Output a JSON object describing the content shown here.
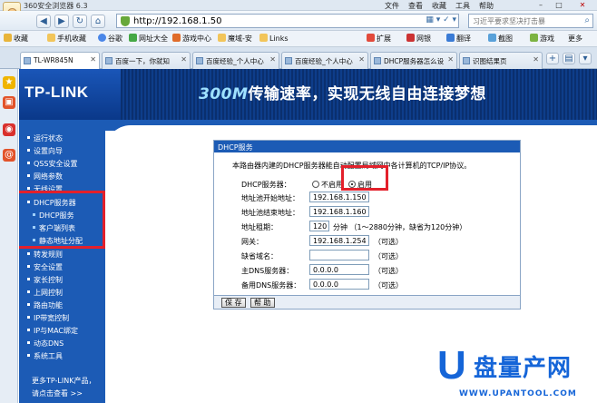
{
  "browser": {
    "title": "360安全浏览器 6.3",
    "menu": [
      "文件",
      "查看",
      "收藏",
      "工具",
      "帮助"
    ],
    "address": "http://192.168.1.50",
    "search_placeholder": "习近平要求坚决打击暴",
    "favorites": [
      "收藏",
      "手机收藏",
      "谷歌",
      "网址大全",
      "游戏中心",
      "魔域-安",
      "Links",
      "扩展",
      "网银",
      "翻译",
      "截图",
      "游戏",
      "更多"
    ],
    "tabs": [
      "TL-WR845N",
      "百度一下，你就知",
      "百度经验_个人中心",
      "百度经验_个人中心",
      "DHCP服务器怎么设",
      "识图结果页"
    ]
  },
  "router": {
    "model": "TL-WR845N",
    "logo": "TP-LINK",
    "slogan_accent": "300M",
    "slogan_rest": "传输速率，实现无线自由连接梦想",
    "menu": [
      {
        "label": "运行状态",
        "sub": false
      },
      {
        "label": "设置向导",
        "sub": false
      },
      {
        "label": "QSS安全设置",
        "sub": false
      },
      {
        "label": "网络参数",
        "sub": false
      },
      {
        "label": "无线设置",
        "sub": false
      },
      {
        "label": "DHCP服务器",
        "sub": false
      },
      {
        "label": "DHCP服务",
        "sub": true
      },
      {
        "label": "客户端列表",
        "sub": true
      },
      {
        "label": "静态地址分配",
        "sub": true
      },
      {
        "label": "转发规则",
        "sub": false
      },
      {
        "label": "安全设置",
        "sub": false
      },
      {
        "label": "家长控制",
        "sub": false
      },
      {
        "label": "上网控制",
        "sub": false
      },
      {
        "label": "路由功能",
        "sub": false
      },
      {
        "label": "IP带宽控制",
        "sub": false
      },
      {
        "label": "IP与MAC绑定",
        "sub": false
      },
      {
        "label": "动态DNS",
        "sub": false
      },
      {
        "label": "系统工具",
        "sub": false
      }
    ],
    "footer_line1": "更多TP-LINK产品，",
    "footer_line2": "请点击查看 >>"
  },
  "dhcp": {
    "header": "DHCP服务",
    "description": "本路由器内建的DHCP服务器能自动配置局域网中各计算机的TCP/IP协议。",
    "server_label": "DHCP服务器：",
    "option_disable": "不启用",
    "option_enable": "启用",
    "selected": "enable",
    "start_label": "地址池开始地址：",
    "start_value": "192.168.1.150",
    "end_label": "地址池结束地址：",
    "end_value": "192.168.1.160",
    "lease_label": "地址租期：",
    "lease_value": "120",
    "lease_hint": "分钟 （1～2880分钟，缺省为120分钟）",
    "gateway_label": "网关：",
    "gateway_value": "192.168.1.254",
    "domain_label": "缺省域名：",
    "domain_value": "",
    "dns1_label": "主DNS服务器：",
    "dns1_value": "0.0.0.0",
    "dns2_label": "备用DNS服务器：",
    "dns2_value": "0.0.0.0",
    "optional": "（可选）",
    "save": "保 存",
    "help": "帮 助"
  },
  "watermark": {
    "letter": "U",
    "text": "盘量产网",
    "url": "WWW.UPANTOOL.COM"
  }
}
